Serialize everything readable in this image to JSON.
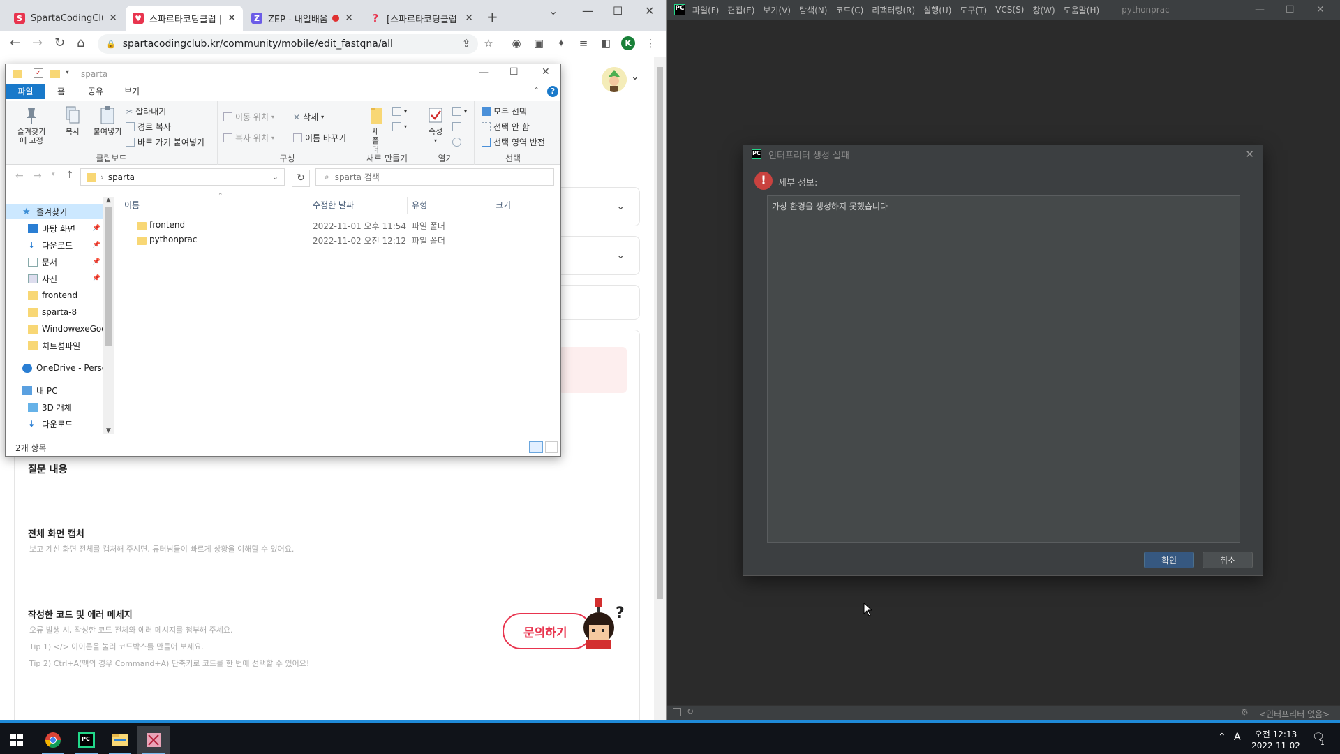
{
  "chrome": {
    "tabs": [
      {
        "title": "SpartaCodingClub",
        "favicon_color": "#e8344e"
      },
      {
        "title": "스파르타코딩클럽 |",
        "favicon_color": "#e8344e"
      },
      {
        "title": "ZEP - 내일배움",
        "favicon_color": "#6b5ce7"
      },
      {
        "title": "[스파르타코딩클럽",
        "favicon_color": "#e8344e"
      }
    ],
    "url": "spartacodingclub.kr/community/mobile/edit_fastqna/all",
    "profile_letter": "K"
  },
  "webpage": {
    "question_title": "질문 내용",
    "screenshot_title": "전체 화면 캡처",
    "screenshot_desc": "보고 계신 화면 전체를 캡처해 주시면, 튜터님들이 빠르게 상황을 이해할 수 있어요.",
    "code_title": "작성한 코드 및 에러 메세지",
    "code_desc": "오류 발생 시, 작성한 코드 전체와 에러 메시지를 첨부해 주세요.",
    "tip1": "Tip 1) </> 아이콘을 눌러 코드박스를 만들어 보세요.",
    "tip2": "Tip 2) Ctrl+A(맥의 경우 Command+A) 단축키로 코드를 한 번에 선택할 수 있어요!",
    "ask_button": "문의하기"
  },
  "explorer": {
    "title": "sparta",
    "ribbon_tabs": [
      "파일",
      "홈",
      "공유",
      "보기"
    ],
    "clipboard": {
      "pin": "즐겨찾기에 고정",
      "copy": "복사",
      "paste": "붙여넣기",
      "cut": "잘라내기",
      "copy_path": "경로 복사",
      "paste_shortcut": "바로 가기 붙여넣기",
      "label": "클립보드"
    },
    "organize": {
      "move_to": "이동 위치",
      "copy_to": "복사 위치",
      "delete": "삭제",
      "rename": "이름 바꾸기",
      "label": "구성"
    },
    "new": {
      "new_folder": "새 폴더",
      "label": "새로 만들기"
    },
    "open": {
      "properties": "속성",
      "label": "열기"
    },
    "select": {
      "select_all": "모두 선택",
      "select_none": "선택 안 함",
      "invert": "선택 영역 반전",
      "label": "선택"
    },
    "address": "sparta",
    "search_placeholder": "sparta 검색",
    "nav": {
      "quick_access": "즐겨찾기",
      "items": [
        "바탕 화면",
        "다운로드",
        "문서",
        "사진",
        "frontend",
        "sparta-8",
        "WindowexeGoo",
        "치트성파일"
      ],
      "onedrive": "OneDrive - Person",
      "this_pc": "내 PC",
      "pc_items": [
        "3D 개체",
        "다운로드"
      ]
    },
    "columns": [
      "이름",
      "수정한 날짜",
      "유형",
      "크기"
    ],
    "files": [
      {
        "name": "frontend",
        "date": "2022-11-01 오후 11:54",
        "type": "파일 폴더"
      },
      {
        "name": "pythonprac",
        "date": "2022-11-02 오전 12:12",
        "type": "파일 폴더"
      }
    ],
    "status": "2개 항목"
  },
  "pycharm": {
    "menus": [
      "파일(F)",
      "편집(E)",
      "보기(V)",
      "탐색(N)",
      "코드(C)",
      "리팩터링(R)",
      "실행(U)",
      "도구(T)",
      "VCS(S)",
      "창(W)",
      "도움말(H)"
    ],
    "project": "pythonprac",
    "status_right": "<인터프리터 없음>",
    "dialog": {
      "title": "인터프리터 생성 실패",
      "detail_label": "세부 정보:",
      "message": "가상 환경을 생성하지 못했습니다",
      "ok": "확인",
      "cancel": "취소"
    }
  },
  "taskbar": {
    "time": "오전 12:13",
    "date": "2022-11-02",
    "ime": "A",
    "notification_count": "1"
  }
}
